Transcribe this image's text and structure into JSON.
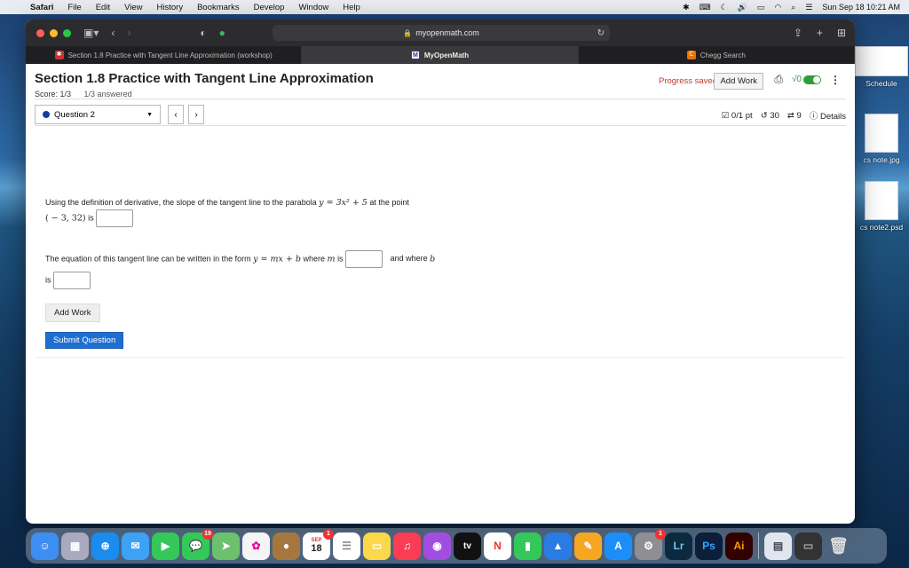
{
  "menubar": {
    "app": "Safari",
    "items": [
      "File",
      "Edit",
      "View",
      "History",
      "Bookmarks",
      "Develop",
      "Window",
      "Help"
    ],
    "clock": "Sun Sep 18  10:21 AM"
  },
  "desktop": {
    "items": [
      {
        "label": "Schedule"
      },
      {
        "label": "cs note.jpg"
      },
      {
        "label": "cs note2.psd"
      }
    ]
  },
  "browser": {
    "url": "myopenmath.com",
    "tabs": [
      {
        "label": "Section 1.8 Practice with Tangent Line Approximation (workshop)",
        "active": false
      },
      {
        "label": "MyOpenMath",
        "active": true
      },
      {
        "label": "Chegg Search",
        "active": false
      }
    ]
  },
  "page": {
    "title": "Section 1.8 Practice with Tangent Line Approximation",
    "score_label": "Score: 1/3",
    "answered": "1/3 answered",
    "progress": "Progress saved",
    "add_work_top": "Add Work",
    "sqrt_label": "√0",
    "question_selector": "Question 2",
    "points": "0/1 pt",
    "retries": "30",
    "attempts": "9",
    "details": "Details",
    "q1_text": "Using the definition of derivative, the slope of the tangent line to the parabola",
    "q1_math": "y = 3x² + 5",
    "q1_mid": "at the point",
    "q1_point": "( − 3, 32)",
    "q1_is": "is",
    "q2_text": "The equation of this tangent line can be written in the form",
    "q2_math": "y = mx + b",
    "q2_where": "where",
    "q2_m": "m",
    "q2_is": "is",
    "q2_andwhere": "and where",
    "q2_b": "b",
    "q2_is2": "is",
    "add_work": "Add Work",
    "submit": "Submit Question"
  },
  "dock": {
    "calendar_month": "SEP",
    "calendar_day": "18",
    "messages_badge": "19",
    "calendar_badge": "1",
    "settings_badge": "1",
    "tv_label": "tv",
    "lr": "Lr",
    "ps": "Ps",
    "ai": "Ai"
  }
}
